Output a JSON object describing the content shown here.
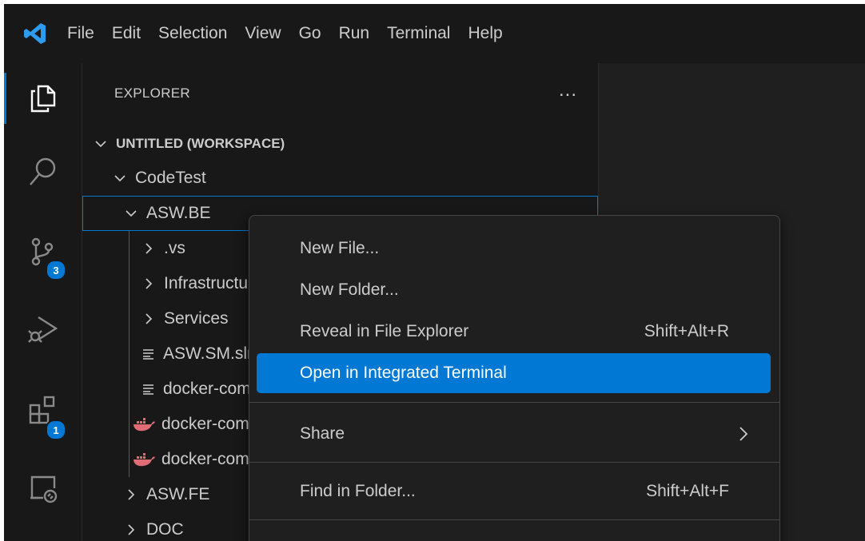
{
  "menubar": {
    "items": [
      "File",
      "Edit",
      "Selection",
      "View",
      "Go",
      "Run",
      "Terminal",
      "Help"
    ]
  },
  "activity_bar": {
    "source_control_badge": "3",
    "extensions_badge": "1"
  },
  "explorer": {
    "title": "EXPLORER",
    "more_actions": "...",
    "workspace_label": "UNTITLED (WORKSPACE)",
    "tree": [
      {
        "label": "CodeTest",
        "depth": 1,
        "kind": "folder-open"
      },
      {
        "label": "ASW.BE",
        "depth": 2,
        "kind": "folder-open",
        "selected": true
      },
      {
        "label": ".vs",
        "depth": 3,
        "kind": "folder-closed"
      },
      {
        "label": "Infrastructure",
        "depth": 3,
        "kind": "folder-closed"
      },
      {
        "label": "Services",
        "depth": 3,
        "kind": "folder-closed"
      },
      {
        "label": "ASW.SM.sln",
        "depth": 3,
        "kind": "file-text"
      },
      {
        "label": "docker-compose.dcproj",
        "depth": 3,
        "kind": "file-text"
      },
      {
        "label": "docker-compose.override.yml",
        "depth": 3,
        "kind": "file-docker"
      },
      {
        "label": "docker-compose.yml",
        "depth": 3,
        "kind": "file-docker"
      },
      {
        "label": "ASW.FE",
        "depth": 2,
        "kind": "folder-closed"
      },
      {
        "label": "DOC",
        "depth": 2,
        "kind": "folder-closed"
      }
    ]
  },
  "context_menu": {
    "items": [
      {
        "label": "New File...",
        "shortcut": ""
      },
      {
        "label": "New Folder...",
        "shortcut": ""
      },
      {
        "label": "Reveal in File Explorer",
        "shortcut": "Shift+Alt+R"
      },
      {
        "label": "Open in Integrated Terminal",
        "shortcut": "",
        "highlighted": true
      },
      {
        "label": "Share",
        "shortcut": "",
        "submenu": true
      },
      {
        "label": "Find in Folder...",
        "shortcut": "Shift+Alt+F"
      }
    ]
  },
  "colors": {
    "accent": "#0078d4",
    "background": "#181818",
    "editor_background": "#1f1f1f",
    "text": "#cccccc",
    "docker_icon": "#e06c75"
  }
}
